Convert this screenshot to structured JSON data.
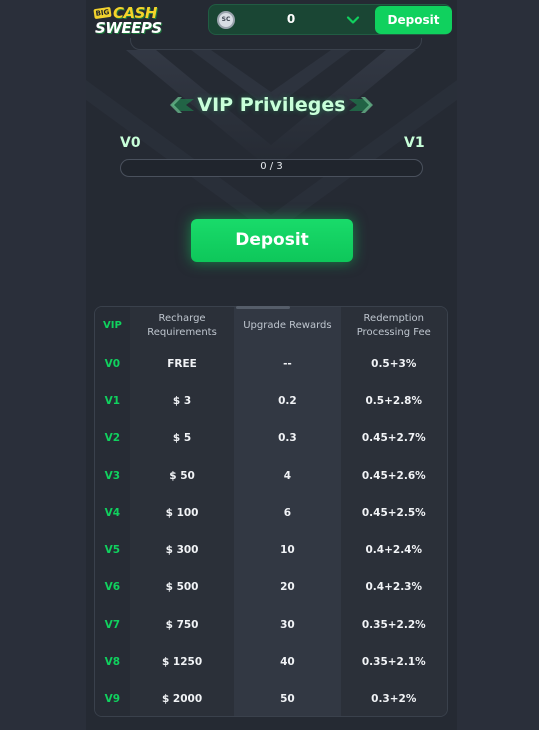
{
  "header": {
    "logo": {
      "big": "BIG",
      "cash": "CASH",
      "sweeps": "SWEEPS"
    },
    "coin_label": "SC",
    "balance": "0",
    "deposit_label": "Deposit"
  },
  "vip": {
    "title": "VIP Privileges",
    "current_level": "V0",
    "next_level": "V1",
    "progress_text": "0 / 3",
    "progress_fraction": 0,
    "deposit_label": "Deposit"
  },
  "table": {
    "headers": {
      "vip": "VIP",
      "recharge": "Recharge Requirements",
      "upgrade": "Upgrade Rewards",
      "fee": "Redemption Processing Fee"
    },
    "rows": [
      {
        "vip": "V0",
        "recharge": "FREE",
        "upgrade": "--",
        "fee": "0.5+3%"
      },
      {
        "vip": "V1",
        "recharge": "$ 3",
        "upgrade": "0.2",
        "fee": "0.5+2.8%"
      },
      {
        "vip": "V2",
        "recharge": "$ 5",
        "upgrade": "0.3",
        "fee": "0.45+2.7%"
      },
      {
        "vip": "V3",
        "recharge": "$ 50",
        "upgrade": "4",
        "fee": "0.45+2.6%"
      },
      {
        "vip": "V4",
        "recharge": "$ 100",
        "upgrade": "6",
        "fee": "0.45+2.5%"
      },
      {
        "vip": "V5",
        "recharge": "$ 300",
        "upgrade": "10",
        "fee": "0.4+2.4%"
      },
      {
        "vip": "V6",
        "recharge": "$ 500",
        "upgrade": "20",
        "fee": "0.4+2.3%"
      },
      {
        "vip": "V7",
        "recharge": "$ 750",
        "upgrade": "30",
        "fee": "0.35+2.2%"
      },
      {
        "vip": "V8",
        "recharge": "$ 1250",
        "upgrade": "40",
        "fee": "0.35+2.1%"
      },
      {
        "vip": "V9",
        "recharge": "$ 2000",
        "upgrade": "50",
        "fee": "0.3+2%"
      }
    ]
  },
  "colors": {
    "accent": "#10d15e",
    "accent_text": "#c8ffd9",
    "background": "#252a33",
    "outer_background": "#2c313c"
  }
}
